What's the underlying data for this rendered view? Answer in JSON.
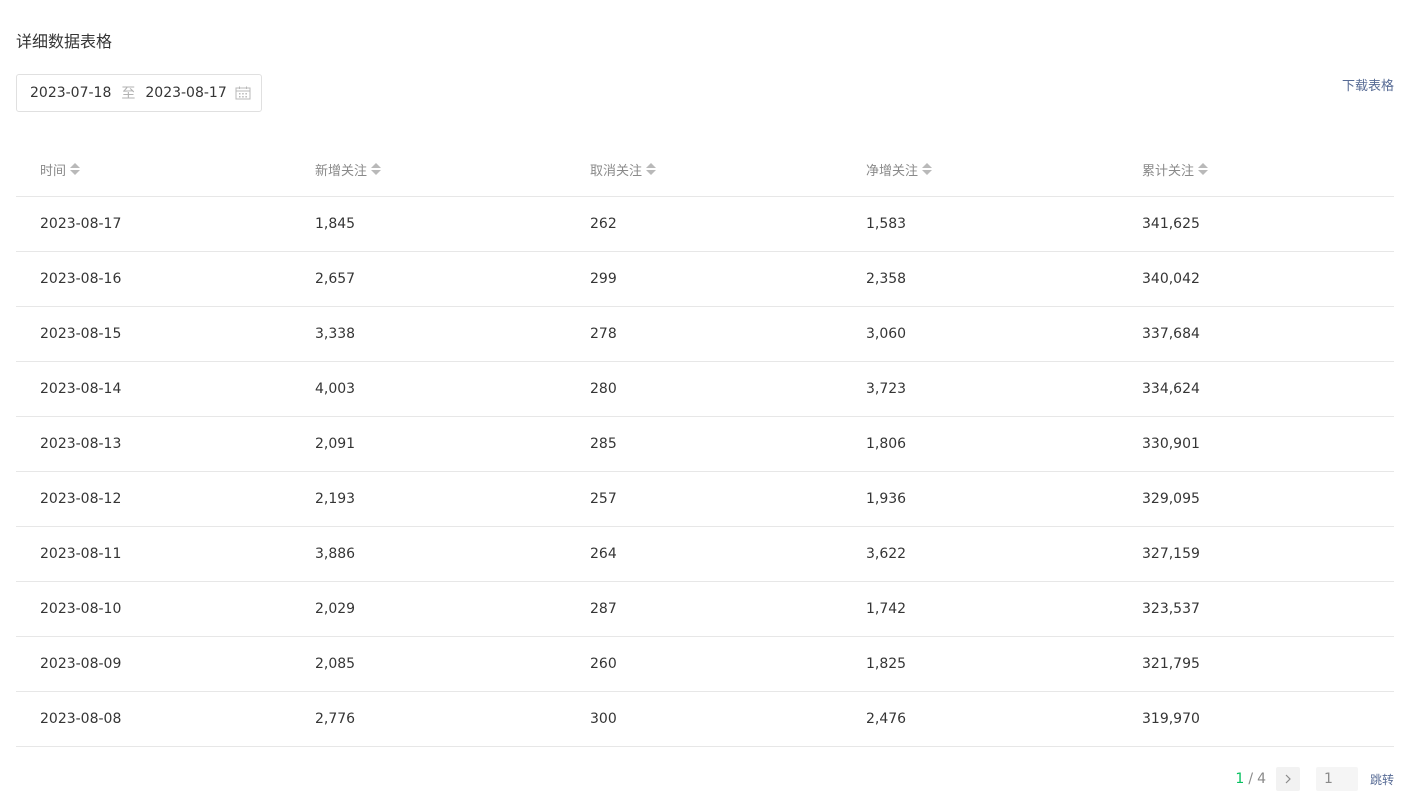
{
  "section": {
    "title": "详细数据表格"
  },
  "date_range": {
    "start": "2023-07-18",
    "separator": "至",
    "end": "2023-08-17",
    "icon": "calendar-icon"
  },
  "download": {
    "label": "下载表格"
  },
  "table": {
    "columns": [
      "时间",
      "新增关注",
      "取消关注",
      "净增关注",
      "累计关注"
    ],
    "rows": [
      [
        "2023-08-17",
        "1,845",
        "262",
        "1,583",
        "341,625"
      ],
      [
        "2023-08-16",
        "2,657",
        "299",
        "2,358",
        "340,042"
      ],
      [
        "2023-08-15",
        "3,338",
        "278",
        "3,060",
        "337,684"
      ],
      [
        "2023-08-14",
        "4,003",
        "280",
        "3,723",
        "334,624"
      ],
      [
        "2023-08-13",
        "2,091",
        "285",
        "1,806",
        "330,901"
      ],
      [
        "2023-08-12",
        "2,193",
        "257",
        "1,936",
        "329,095"
      ],
      [
        "2023-08-11",
        "3,886",
        "264",
        "3,622",
        "327,159"
      ],
      [
        "2023-08-10",
        "2,029",
        "287",
        "1,742",
        "323,537"
      ],
      [
        "2023-08-09",
        "2,085",
        "260",
        "1,825",
        "321,795"
      ],
      [
        "2023-08-08",
        "2,776",
        "300",
        "2,476",
        "319,970"
      ]
    ]
  },
  "pagination": {
    "current": "1",
    "separator": "/",
    "total": "4",
    "next_icon": "chevron-right-icon",
    "input_value": "1",
    "jump_label": "跳转"
  },
  "colors": {
    "accent_green": "#07c160",
    "link_blue": "#576b95",
    "border": "#e7e7e7"
  }
}
